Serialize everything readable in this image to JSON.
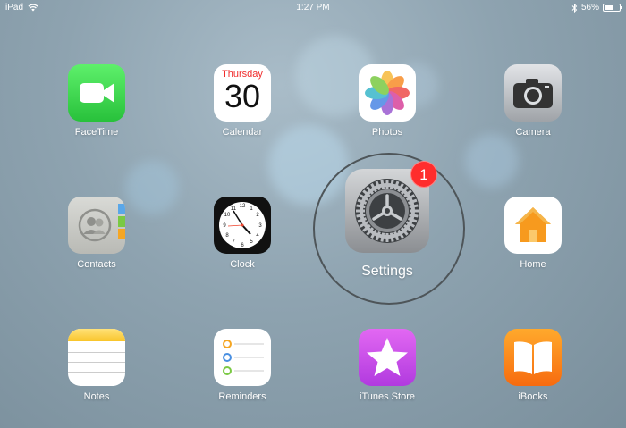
{
  "status_bar": {
    "carrier": "iPad",
    "wifi_icon": "wifi-icon",
    "time": "1:27 PM",
    "bluetooth_icon": "bluetooth-icon",
    "battery_percent": "56%",
    "battery_level": 0.56
  },
  "apps": {
    "facetime": {
      "label": "FaceTime",
      "icon": "facetime-icon"
    },
    "calendar": {
      "label": "Calendar",
      "day": "Thursday",
      "date": "30"
    },
    "photos": {
      "label": "Photos",
      "icon": "photos-icon"
    },
    "camera": {
      "label": "Camera",
      "icon": "camera-icon"
    },
    "contacts": {
      "label": "Contacts",
      "icon": "contacts-icon"
    },
    "clock": {
      "label": "Clock",
      "icon": "clock-icon"
    },
    "settings": {
      "label": "Settings",
      "badge": "1",
      "icon": "gear-icon"
    },
    "home": {
      "label": "Home",
      "icon": "home-icon"
    },
    "notes": {
      "label": "Notes",
      "icon": "notes-icon"
    },
    "reminders": {
      "label": "Reminders",
      "icon": "reminders-icon"
    },
    "itunes_store": {
      "label": "iTunes Store",
      "icon": "star-icon"
    },
    "ibooks": {
      "label": "iBooks",
      "icon": "book-icon"
    }
  },
  "colors": {
    "badge": "#ff2d2d",
    "facetime": "#28c13b",
    "itunes": "#b13adf",
    "ibooks": "#f76b0f",
    "home": "#f79a1e",
    "calendar_day": "#f02b2b"
  }
}
